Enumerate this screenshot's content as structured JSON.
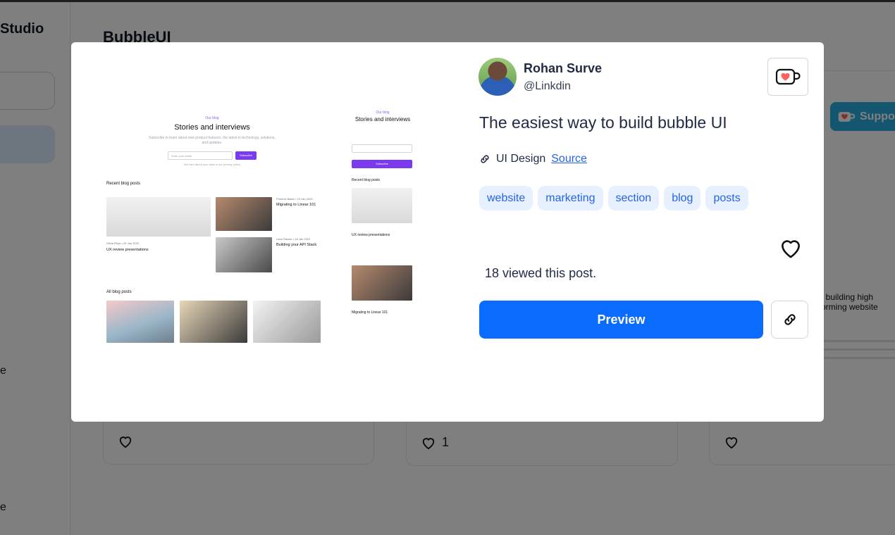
{
  "background": {
    "sidebar": {
      "brand": "Studio",
      "items": [
        "e",
        "e"
      ]
    },
    "main_title": "BubbleUI",
    "support_label": "Suppo",
    "cards": [
      {
        "likes": ""
      },
      {
        "likes": "1"
      },
      {
        "likes": ""
      }
    ],
    "right_thumb": {
      "top_text": "t building high",
      "bottom_text": "orming website"
    }
  },
  "modal": {
    "preview": {
      "desktop": {
        "eyebrow": "Our blog",
        "title": "Stories and interviews",
        "subtitle": "Subscribe to learn about new product features, the latest in technology, solutions, and updates.",
        "input_placeholder": "Enter your email",
        "button": "Subscribe",
        "note": "We care about your data in our privacy policy",
        "section_recent": "Recent blog posts",
        "post1_meta": "Phoenix Baker • 19 Jan 2022",
        "post1_title": "Migrating to Linear 101",
        "post2_meta": "Olivia Rhye • 20 Jan 2022",
        "post2_title": "UX review presentations",
        "post3_meta": "Lana Steiner • 18 Jan 2022",
        "post3_title": "Building your API Stack",
        "section_all": "All blog posts"
      },
      "mobile": {
        "eyebrow": "Our blog",
        "title": "Stories and interviews",
        "button": "Subscribe",
        "section_recent": "Recent blog posts",
        "post1_title": "UX review presentations",
        "post2_title": "Migrating to Linear 101"
      }
    },
    "author": {
      "name": "Rohan Surve",
      "handle": "@Linkdin"
    },
    "title": "The easiest way to build bubble UI",
    "category": "UI Design",
    "source_label": "Source",
    "tags": [
      "website",
      "marketing",
      "section",
      "blog",
      "posts"
    ],
    "views_text": "18 viewed this post.",
    "preview_button": "Preview",
    "icons": {
      "kofi": "kofi-cup-icon",
      "heart": "heart-icon",
      "link": "link-icon"
    },
    "colors": {
      "primary": "#0a6cff",
      "tag_bg": "#e7f0ff",
      "tag_text": "#2563eb"
    }
  }
}
